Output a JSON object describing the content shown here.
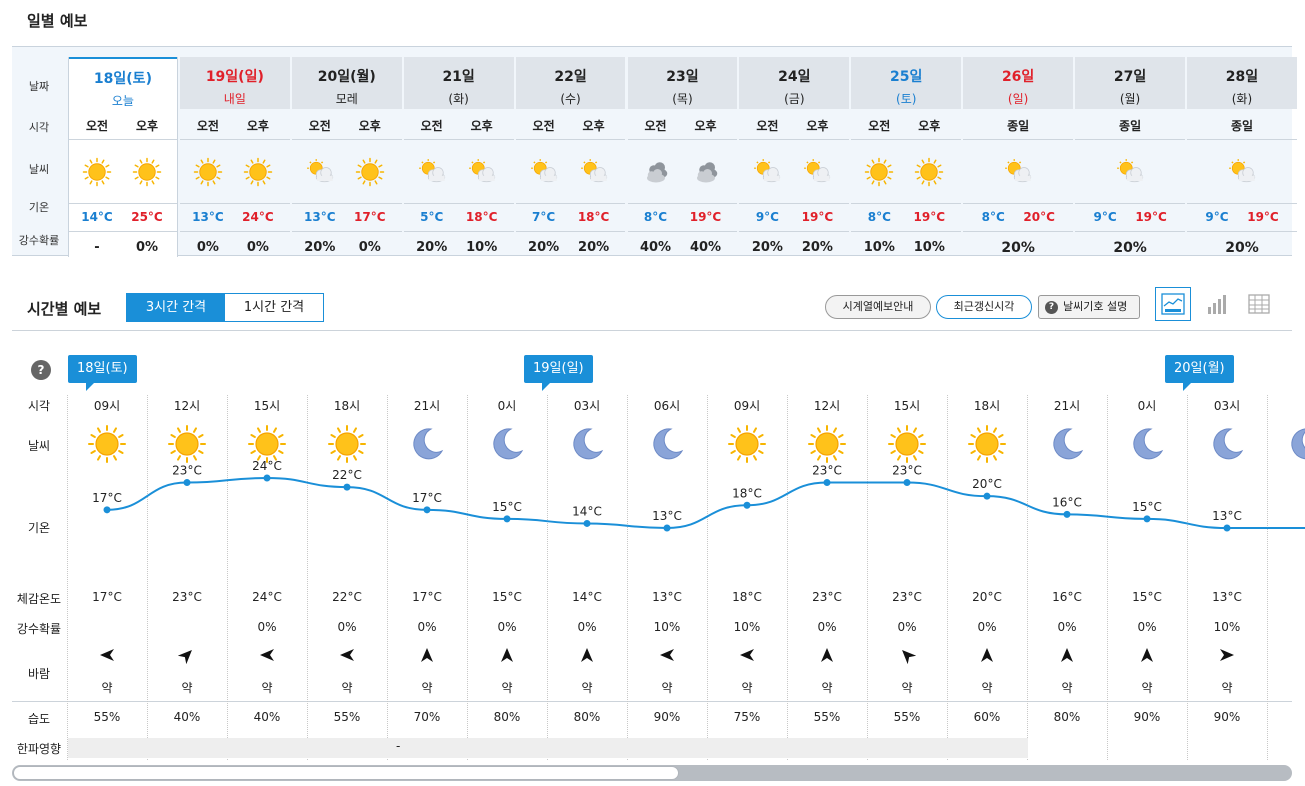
{
  "daily": {
    "title": "일별 예보",
    "row_labels": {
      "date": "날짜",
      "time": "시각",
      "weather": "날씨",
      "temp": "기온",
      "precip": "강수확률"
    },
    "days": [
      {
        "date": "18일(토)",
        "sub": "오늘",
        "color": "blue",
        "today": true,
        "split": true,
        "am_label": "오전",
        "pm_label": "오후",
        "am_icon": "sun",
        "pm_icon": "sun",
        "min": "14°C",
        "max": "25°C",
        "am_precip": "-",
        "pm_precip": "0%"
      },
      {
        "date": "19일(일)",
        "sub": "내일",
        "color": "red",
        "split": true,
        "am_label": "오전",
        "pm_label": "오후",
        "am_icon": "sun",
        "pm_icon": "sun",
        "min": "13°C",
        "max": "24°C",
        "am_precip": "0%",
        "pm_precip": "0%"
      },
      {
        "date": "20일(월)",
        "sub": "모레",
        "color": "dark",
        "split": true,
        "am_label": "오전",
        "pm_label": "오후",
        "am_icon": "partly-cloudy",
        "pm_icon": "sun",
        "min": "13°C",
        "max": "17°C",
        "am_precip": "20%",
        "pm_precip": "0%"
      },
      {
        "date": "21일",
        "sub": "(화)",
        "color": "dark",
        "split": true,
        "am_label": "오전",
        "pm_label": "오후",
        "am_icon": "partly-cloudy",
        "pm_icon": "partly-cloudy",
        "min": "5°C",
        "max": "18°C",
        "am_precip": "20%",
        "pm_precip": "10%"
      },
      {
        "date": "22일",
        "sub": "(수)",
        "color": "dark",
        "split": true,
        "am_label": "오전",
        "pm_label": "오후",
        "am_icon": "partly-cloudy",
        "pm_icon": "partly-cloudy",
        "min": "7°C",
        "max": "18°C",
        "am_precip": "20%",
        "pm_precip": "20%"
      },
      {
        "date": "23일",
        "sub": "(목)",
        "color": "dark",
        "split": true,
        "am_label": "오전",
        "pm_label": "오후",
        "am_icon": "cloudy",
        "pm_icon": "cloudy",
        "min": "8°C",
        "max": "19°C",
        "am_precip": "40%",
        "pm_precip": "40%"
      },
      {
        "date": "24일",
        "sub": "(금)",
        "color": "dark",
        "split": true,
        "am_label": "오전",
        "pm_label": "오후",
        "am_icon": "partly-cloudy",
        "pm_icon": "partly-cloudy",
        "min": "9°C",
        "max": "19°C",
        "am_precip": "20%",
        "pm_precip": "20%"
      },
      {
        "date": "25일",
        "sub": "(토)",
        "color": "blue",
        "split": true,
        "am_label": "오전",
        "pm_label": "오후",
        "am_icon": "sun",
        "pm_icon": "sun",
        "min": "8°C",
        "max": "19°C",
        "am_precip": "10%",
        "pm_precip": "10%"
      },
      {
        "date": "26일",
        "sub": "(일)",
        "color": "red",
        "split": false,
        "all_label": "종일",
        "icon": "partly-cloudy",
        "min": "8°C",
        "max": "20°C",
        "precip": "20%"
      },
      {
        "date": "27일",
        "sub": "(월)",
        "color": "dark",
        "split": false,
        "all_label": "종일",
        "icon": "partly-cloudy",
        "min": "9°C",
        "max": "19°C",
        "precip": "20%"
      },
      {
        "date": "28일",
        "sub": "(화)",
        "color": "dark",
        "split": false,
        "all_label": "종일",
        "icon": "partly-cloudy",
        "min": "9°C",
        "max": "19°C",
        "precip": "20%"
      }
    ]
  },
  "hourly": {
    "title": "시간별 예보",
    "tabs": [
      "3시간 간격",
      "1시간 간격"
    ],
    "buttons": {
      "timeseries": "시계열예보안내",
      "latest": "최근갱신시각",
      "legend": "날씨기호 설명"
    },
    "help_icon": "question-icon",
    "row_labels": {
      "time": "시각",
      "weather": "날씨",
      "temp": "기온",
      "feels": "체감온도",
      "precip": "강수확률",
      "wind": "바람",
      "humidity": "습도",
      "coldwave": "한파영향"
    },
    "date_tags": [
      "18일(토)",
      "19일(일)",
      "20일(월)"
    ],
    "slots": [
      {
        "time": "09시",
        "icon": "sun",
        "temp": 17,
        "temp_label": "17°C",
        "feels": "17°C",
        "precip": "",
        "wind_dir": "from-east",
        "wind": "약",
        "humidity": "55%"
      },
      {
        "time": "12시",
        "icon": "sun",
        "temp": 23,
        "temp_label": "23°C",
        "feels": "23°C",
        "precip": "",
        "wind_dir": "from-southwest",
        "wind": "약",
        "humidity": "40%"
      },
      {
        "time": "15시",
        "icon": "sun",
        "temp": 24,
        "temp_label": "24°C",
        "feels": "24°C",
        "precip": "0%",
        "wind_dir": "from-east",
        "wind": "약",
        "humidity": "40%"
      },
      {
        "time": "18시",
        "icon": "sun",
        "temp": 22,
        "temp_label": "22°C",
        "feels": "22°C",
        "precip": "0%",
        "wind_dir": "from-east",
        "wind": "약",
        "humidity": "55%"
      },
      {
        "time": "21시",
        "icon": "moon",
        "temp": 17,
        "temp_label": "17°C",
        "feels": "17°C",
        "precip": "0%",
        "wind_dir": "from-south",
        "wind": "약",
        "humidity": "70%"
      },
      {
        "time": "0시",
        "icon": "moon",
        "temp": 15,
        "temp_label": "15°C",
        "feels": "15°C",
        "precip": "0%",
        "wind_dir": "from-south",
        "wind": "약",
        "humidity": "80%"
      },
      {
        "time": "03시",
        "icon": "moon",
        "temp": 14,
        "temp_label": "14°C",
        "feels": "14°C",
        "precip": "0%",
        "wind_dir": "from-south",
        "wind": "약",
        "humidity": "80%"
      },
      {
        "time": "06시",
        "icon": "moon",
        "temp": 13,
        "temp_label": "13°C",
        "feels": "13°C",
        "precip": "10%",
        "wind_dir": "from-east",
        "wind": "약",
        "humidity": "90%"
      },
      {
        "time": "09시",
        "icon": "sun",
        "temp": 18,
        "temp_label": "18°C",
        "feels": "18°C",
        "precip": "10%",
        "wind_dir": "from-east",
        "wind": "약",
        "humidity": "75%"
      },
      {
        "time": "12시",
        "icon": "sun",
        "temp": 23,
        "temp_label": "23°C",
        "feels": "23°C",
        "precip": "0%",
        "wind_dir": "from-south",
        "wind": "약",
        "humidity": "55%"
      },
      {
        "time": "15시",
        "icon": "sun",
        "temp": 23,
        "temp_label": "23°C",
        "feels": "23°C",
        "precip": "0%",
        "wind_dir": "from-southeast",
        "wind": "약",
        "humidity": "55%"
      },
      {
        "time": "18시",
        "icon": "sun",
        "temp": 20,
        "temp_label": "20°C",
        "feels": "20°C",
        "precip": "0%",
        "wind_dir": "from-south",
        "wind": "약",
        "humidity": "60%"
      },
      {
        "time": "21시",
        "icon": "moon",
        "temp": 16,
        "temp_label": "16°C",
        "feels": "16°C",
        "precip": "0%",
        "wind_dir": "from-south",
        "wind": "약",
        "humidity": "80%"
      },
      {
        "time": "0시",
        "icon": "moon",
        "temp": 15,
        "temp_label": "15°C",
        "feels": "15°C",
        "precip": "0%",
        "wind_dir": "from-south",
        "wind": "약",
        "humidity": "90%"
      },
      {
        "time": "03시",
        "icon": "moon",
        "temp": 13,
        "temp_label": "13°C",
        "feels": "13°C",
        "precip": "10%",
        "wind_dir": "from-west",
        "wind": "약",
        "humidity": "90%"
      }
    ],
    "coldwave": "-"
  },
  "colors": {
    "accent": "#1a8fd8",
    "red": "#e0202a",
    "line": "#1a8fd8",
    "sun": "#f7b500"
  }
}
